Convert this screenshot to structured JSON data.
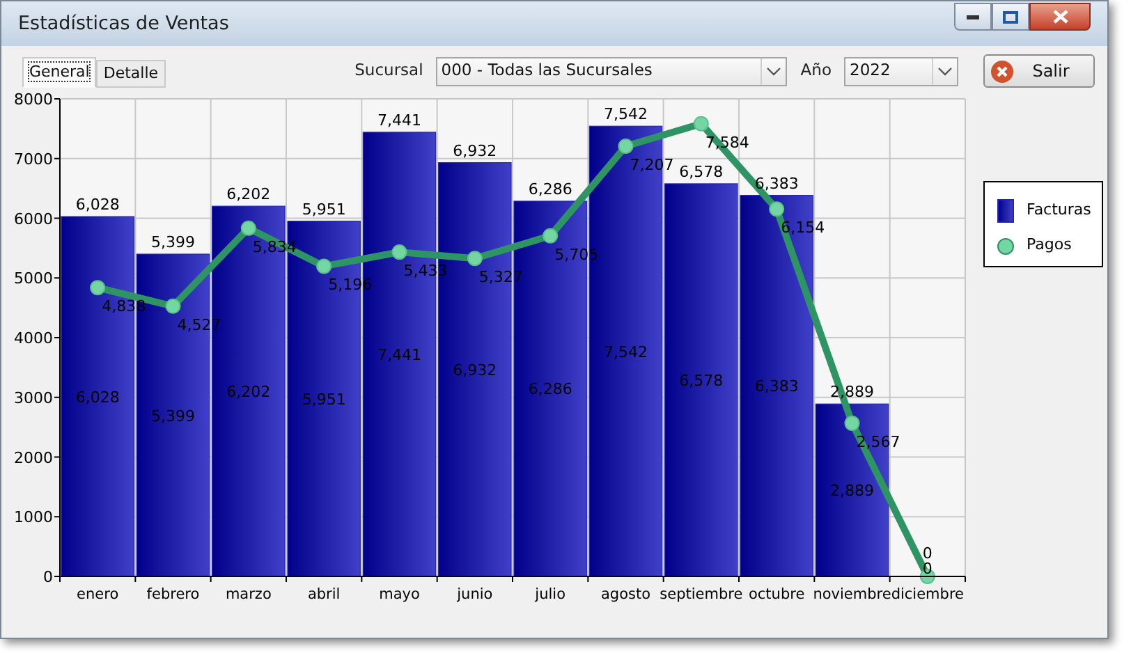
{
  "window": {
    "title": "Estadísticas de Ventas"
  },
  "tabs": [
    {
      "label": "General",
      "selected": true
    },
    {
      "label": "Detalle",
      "selected": false
    }
  ],
  "filters": [
    {
      "label": "Sucursal",
      "value": "000 - Todas las Sucursales",
      "kind": "wide"
    },
    {
      "label": "Año",
      "value": "2022",
      "kind": "narrow"
    }
  ],
  "buttons": [
    {
      "label": "Salir"
    }
  ],
  "chart": {
    "chart_data": {
      "type": "bar",
      "categories": [
        "enero",
        "febrero",
        "marzo",
        "abril",
        "mayo",
        "junio",
        "julio",
        "agosto",
        "septiembre",
        "octubre",
        "noviembre",
        "diciembre"
      ],
      "series": [
        {
          "name": "Facturas",
          "color": "#2424b0",
          "values": [
            6028,
            5399,
            6202,
            5951,
            7441,
            6932,
            6286,
            7542,
            6578,
            6383,
            2889,
            0
          ],
          "value_labels": [
            "6,028",
            "5,399",
            "6,202",
            "5,951",
            "7,441",
            "6,932",
            "6,286",
            "7,542",
            "6,578",
            "6,383",
            "2,889",
            "0"
          ]
        },
        {
          "name": "Pagos",
          "type": "line",
          "marker": true,
          "color": "#2e9464",
          "values": [
            4838,
            4527,
            5834,
            5196,
            5433,
            5327,
            5705,
            7207,
            7584,
            6154,
            2567,
            0
          ],
          "value_labels": [
            "4,838",
            "4,527",
            "5,834",
            "5,196",
            "5,433",
            "5,327",
            "5,705",
            "7,207",
            "7,584",
            "6,154",
            "2,567",
            "0"
          ]
        }
      ],
      "ylim": [
        0,
        8000
      ],
      "yticks": [
        0,
        1000,
        2000,
        3000,
        4000,
        5000,
        6000,
        7000,
        8000
      ],
      "grid": true,
      "annotations": [
        "6,028",
        "5,399",
        "6,202",
        "5,951",
        "7,441",
        "6,932",
        "6,286",
        "7,542",
        "6,578",
        "6,383",
        "2,889"
      ]
    }
  }
}
